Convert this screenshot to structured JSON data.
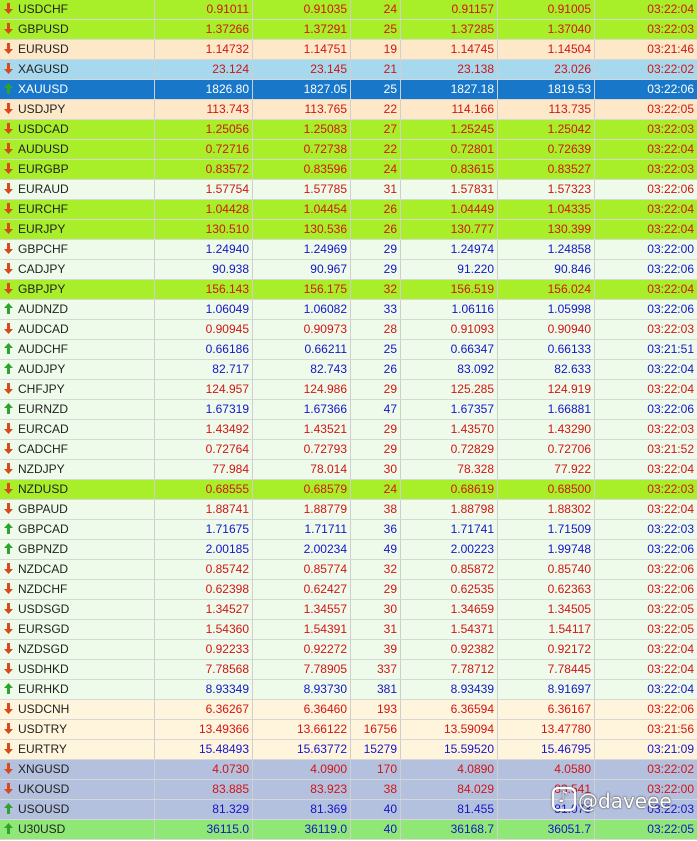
{
  "colors": {
    "red": "#d21414",
    "blue": "#1414c8",
    "lime": "#a8ef2a",
    "peach": "#fde8c8",
    "sky": "#a6d8ee",
    "navy": "#1877c8",
    "mint": "#eefbea",
    "cream": "#fff5dc",
    "slate": "#b3c0de",
    "green": "#8fe876",
    "arrow_up": "#2ea42e",
    "arrow_down": "#d84a1c"
  },
  "watermark": {
    "handle": "@daveee"
  },
  "rows": [
    {
      "symbol": "USDCHF",
      "bid": "0.91011",
      "ask": "0.91035",
      "spread": "24",
      "high": "0.91157",
      "low": "0.91005",
      "time": "03:22:04",
      "dir": "down",
      "bg": "lime",
      "color": "red"
    },
    {
      "symbol": "GBPUSD",
      "bid": "1.37266",
      "ask": "1.37291",
      "spread": "25",
      "high": "1.37285",
      "low": "1.37040",
      "time": "03:22:03",
      "dir": "down",
      "bg": "lime",
      "color": "red"
    },
    {
      "symbol": "EURUSD",
      "bid": "1.14732",
      "ask": "1.14751",
      "spread": "19",
      "high": "1.14745",
      "low": "1.14504",
      "time": "03:21:46",
      "dir": "down",
      "bg": "peach",
      "color": "red"
    },
    {
      "symbol": "XAGUSD",
      "bid": "23.124",
      "ask": "23.145",
      "spread": "21",
      "high": "23.138",
      "low": "23.026",
      "time": "03:22:02",
      "dir": "down",
      "bg": "sky",
      "color": "red"
    },
    {
      "symbol": "XAUUSD",
      "bid": "1826.80",
      "ask": "1827.05",
      "spread": "25",
      "high": "1827.18",
      "low": "1819.53",
      "time": "03:22:06",
      "dir": "up",
      "bg": "navy",
      "color": "white",
      "selected": true
    },
    {
      "symbol": "USDJPY",
      "bid": "113.743",
      "ask": "113.765",
      "spread": "22",
      "high": "114.166",
      "low": "113.735",
      "time": "03:22:05",
      "dir": "down",
      "bg": "peach",
      "color": "red"
    },
    {
      "symbol": "USDCAD",
      "bid": "1.25056",
      "ask": "1.25083",
      "spread": "27",
      "high": "1.25245",
      "low": "1.25042",
      "time": "03:22:03",
      "dir": "down",
      "bg": "lime",
      "color": "red"
    },
    {
      "symbol": "AUDUSD",
      "bid": "0.72716",
      "ask": "0.72738",
      "spread": "22",
      "high": "0.72801",
      "low": "0.72639",
      "time": "03:22:04",
      "dir": "down",
      "bg": "lime",
      "color": "red"
    },
    {
      "symbol": "EURGBP",
      "bid": "0.83572",
      "ask": "0.83596",
      "spread": "24",
      "high": "0.83615",
      "low": "0.83527",
      "time": "03:22:03",
      "dir": "down",
      "bg": "lime",
      "color": "red"
    },
    {
      "symbol": "EURAUD",
      "bid": "1.57754",
      "ask": "1.57785",
      "spread": "31",
      "high": "1.57831",
      "low": "1.57323",
      "time": "03:22:06",
      "dir": "down",
      "bg": "mint",
      "color": "red"
    },
    {
      "symbol": "EURCHF",
      "bid": "1.04428",
      "ask": "1.04454",
      "spread": "26",
      "high": "1.04449",
      "low": "1.04335",
      "time": "03:22:04",
      "dir": "down",
      "bg": "lime",
      "color": "red"
    },
    {
      "symbol": "EURJPY",
      "bid": "130.510",
      "ask": "130.536",
      "spread": "26",
      "high": "130.777",
      "low": "130.399",
      "time": "03:22:04",
      "dir": "down",
      "bg": "lime",
      "color": "red"
    },
    {
      "symbol": "GBPCHF",
      "bid": "1.24940",
      "ask": "1.24969",
      "spread": "29",
      "high": "1.24974",
      "low": "1.24858",
      "time": "03:22:00",
      "dir": "down",
      "bg": "mint",
      "color": "blue"
    },
    {
      "symbol": "CADJPY",
      "bid": "90.938",
      "ask": "90.967",
      "spread": "29",
      "high": "91.220",
      "low": "90.846",
      "time": "03:22:06",
      "dir": "down",
      "bg": "mint",
      "color": "blue"
    },
    {
      "symbol": "GBPJPY",
      "bid": "156.143",
      "ask": "156.175",
      "spread": "32",
      "high": "156.519",
      "low": "156.024",
      "time": "03:22:04",
      "dir": "down",
      "bg": "lime",
      "color": "red"
    },
    {
      "symbol": "AUDNZD",
      "bid": "1.06049",
      "ask": "1.06082",
      "spread": "33",
      "high": "1.06116",
      "low": "1.05998",
      "time": "03:22:06",
      "dir": "up",
      "bg": "mint",
      "color": "blue"
    },
    {
      "symbol": "AUDCAD",
      "bid": "0.90945",
      "ask": "0.90973",
      "spread": "28",
      "high": "0.91093",
      "low": "0.90940",
      "time": "03:22:03",
      "dir": "down",
      "bg": "mint",
      "color": "red"
    },
    {
      "symbol": "AUDCHF",
      "bid": "0.66186",
      "ask": "0.66211",
      "spread": "25",
      "high": "0.66347",
      "low": "0.66133",
      "time": "03:21:51",
      "dir": "up",
      "bg": "mint",
      "color": "blue"
    },
    {
      "symbol": "AUDJPY",
      "bid": "82.717",
      "ask": "82.743",
      "spread": "26",
      "high": "83.092",
      "low": "82.633",
      "time": "03:22:04",
      "dir": "up",
      "bg": "mint",
      "color": "blue"
    },
    {
      "symbol": "CHFJPY",
      "bid": "124.957",
      "ask": "124.986",
      "spread": "29",
      "high": "125.285",
      "low": "124.919",
      "time": "03:22:04",
      "dir": "down",
      "bg": "mint",
      "color": "red"
    },
    {
      "symbol": "EURNZD",
      "bid": "1.67319",
      "ask": "1.67366",
      "spread": "47",
      "high": "1.67357",
      "low": "1.66881",
      "time": "03:22:06",
      "dir": "up",
      "bg": "mint",
      "color": "blue"
    },
    {
      "symbol": "EURCAD",
      "bid": "1.43492",
      "ask": "1.43521",
      "spread": "29",
      "high": "1.43570",
      "low": "1.43290",
      "time": "03:22:03",
      "dir": "down",
      "bg": "mint",
      "color": "red"
    },
    {
      "symbol": "CADCHF",
      "bid": "0.72764",
      "ask": "0.72793",
      "spread": "29",
      "high": "0.72829",
      "low": "0.72706",
      "time": "03:21:52",
      "dir": "down",
      "bg": "mint",
      "color": "red"
    },
    {
      "symbol": "NZDJPY",
      "bid": "77.984",
      "ask": "78.014",
      "spread": "30",
      "high": "78.328",
      "low": "77.922",
      "time": "03:22:04",
      "dir": "down",
      "bg": "mint",
      "color": "red"
    },
    {
      "symbol": "NZDUSD",
      "bid": "0.68555",
      "ask": "0.68579",
      "spread": "24",
      "high": "0.68619",
      "low": "0.68500",
      "time": "03:22:03",
      "dir": "down",
      "bg": "lime",
      "color": "red"
    },
    {
      "symbol": "GBPAUD",
      "bid": "1.88741",
      "ask": "1.88779",
      "spread": "38",
      "high": "1.88798",
      "low": "1.88302",
      "time": "03:22:04",
      "dir": "down",
      "bg": "mint",
      "color": "red"
    },
    {
      "symbol": "GBPCAD",
      "bid": "1.71675",
      "ask": "1.71711",
      "spread": "36",
      "high": "1.71741",
      "low": "1.71509",
      "time": "03:22:03",
      "dir": "up",
      "bg": "mint",
      "color": "blue"
    },
    {
      "symbol": "GBPNZD",
      "bid": "2.00185",
      "ask": "2.00234",
      "spread": "49",
      "high": "2.00223",
      "low": "1.99748",
      "time": "03:22:06",
      "dir": "up",
      "bg": "mint",
      "color": "blue"
    },
    {
      "symbol": "NZDCAD",
      "bid": "0.85742",
      "ask": "0.85774",
      "spread": "32",
      "high": "0.85872",
      "low": "0.85740",
      "time": "03:22:06",
      "dir": "down",
      "bg": "mint",
      "color": "red"
    },
    {
      "symbol": "NZDCHF",
      "bid": "0.62398",
      "ask": "0.62427",
      "spread": "29",
      "high": "0.62535",
      "low": "0.62363",
      "time": "03:22:06",
      "dir": "down",
      "bg": "mint",
      "color": "red"
    },
    {
      "symbol": "USDSGD",
      "bid": "1.34527",
      "ask": "1.34557",
      "spread": "30",
      "high": "1.34659",
      "low": "1.34505",
      "time": "03:22:05",
      "dir": "down",
      "bg": "mint",
      "color": "red"
    },
    {
      "symbol": "EURSGD",
      "bid": "1.54360",
      "ask": "1.54391",
      "spread": "31",
      "high": "1.54371",
      "low": "1.54117",
      "time": "03:22:05",
      "dir": "down",
      "bg": "mint",
      "color": "red"
    },
    {
      "symbol": "NZDSGD",
      "bid": "0.92233",
      "ask": "0.92272",
      "spread": "39",
      "high": "0.92382",
      "low": "0.92172",
      "time": "03:22:04",
      "dir": "down",
      "bg": "mint",
      "color": "red"
    },
    {
      "symbol": "USDHKD",
      "bid": "7.78568",
      "ask": "7.78905",
      "spread": "337",
      "high": "7.78712",
      "low": "7.78445",
      "time": "03:22:04",
      "dir": "down",
      "bg": "mint",
      "color": "red"
    },
    {
      "symbol": "EURHKD",
      "bid": "8.93349",
      "ask": "8.93730",
      "spread": "381",
      "high": "8.93439",
      "low": "8.91697",
      "time": "03:22:04",
      "dir": "up",
      "bg": "mint",
      "color": "blue"
    },
    {
      "symbol": "USDCNH",
      "bid": "6.36267",
      "ask": "6.36460",
      "spread": "193",
      "high": "6.36594",
      "low": "6.36167",
      "time": "03:22:06",
      "dir": "down",
      "bg": "cream",
      "color": "red"
    },
    {
      "symbol": "USDTRY",
      "bid": "13.49366",
      "ask": "13.66122",
      "spread": "16756",
      "high": "13.59094",
      "low": "13.47780",
      "time": "03:21:56",
      "dir": "down",
      "bg": "cream",
      "color": "red"
    },
    {
      "symbol": "EURTRY",
      "bid": "15.48493",
      "ask": "15.63772",
      "spread": "15279",
      "high": "15.59520",
      "low": "15.46795",
      "time": "03:21:09",
      "dir": "down",
      "bg": "cream",
      "color": "blue"
    },
    {
      "symbol": "XNGUSD",
      "bid": "4.0730",
      "ask": "4.0900",
      "spread": "170",
      "high": "4.0890",
      "low": "4.0580",
      "time": "03:22:02",
      "dir": "down",
      "bg": "slate",
      "color": "red"
    },
    {
      "symbol": "UKOUSD",
      "bid": "83.885",
      "ask": "83.923",
      "spread": "38",
      "high": "84.029",
      "low": "83.541",
      "time": "03:22:00",
      "dir": "down",
      "bg": "slate",
      "color": "red"
    },
    {
      "symbol": "USOUSD",
      "bid": "81.329",
      "ask": "81.369",
      "spread": "40",
      "high": "81.455",
      "low": "81.073",
      "time": "03:22:03",
      "dir": "up",
      "bg": "slate",
      "color": "blue"
    },
    {
      "symbol": "U30USD",
      "bid": "36115.0",
      "ask": "36119.0",
      "spread": "40",
      "high": "36168.7",
      "low": "36051.7",
      "time": "03:22:05",
      "dir": "up",
      "bg": "green",
      "color": "blue"
    }
  ]
}
